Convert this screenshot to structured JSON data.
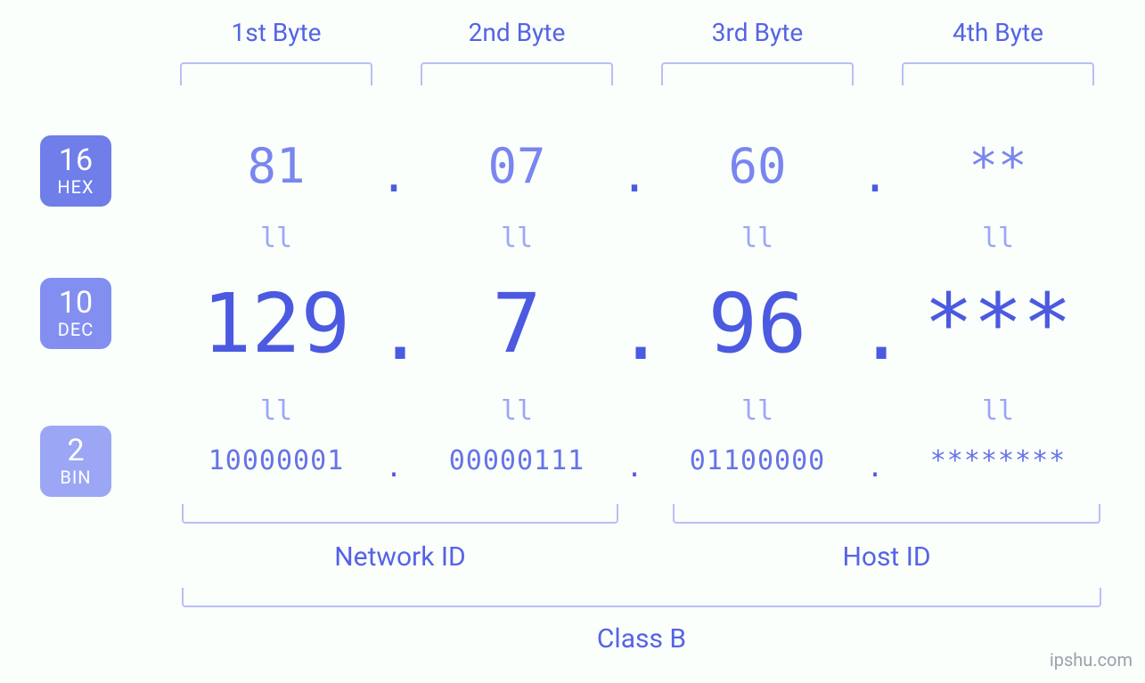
{
  "bases": {
    "hex": {
      "num": "16",
      "label": "HEX"
    },
    "dec": {
      "num": "10",
      "label": "DEC"
    },
    "bin": {
      "num": "2",
      "label": "BIN"
    }
  },
  "byte_headers": [
    "1st Byte",
    "2nd Byte",
    "3rd Byte",
    "4th Byte"
  ],
  "equals_glyph": "ll",
  "dot_glyph": ".",
  "bytes": [
    {
      "hex": "81",
      "dec": "129",
      "bin": "10000001"
    },
    {
      "hex": "07",
      "dec": "7",
      "bin": "00000111"
    },
    {
      "hex": "60",
      "dec": "96",
      "bin": "01100000"
    },
    {
      "hex": "**",
      "dec": "***",
      "bin": "********"
    }
  ],
  "groups": {
    "network": "Network ID",
    "host": "Host ID",
    "class": "Class B"
  },
  "watermark": "ipshu.com",
  "colors": {
    "dark": "#4b5ae0",
    "mid": "#7a86ef",
    "light": "#9ba7f4",
    "rule": "#b7c0f6"
  }
}
